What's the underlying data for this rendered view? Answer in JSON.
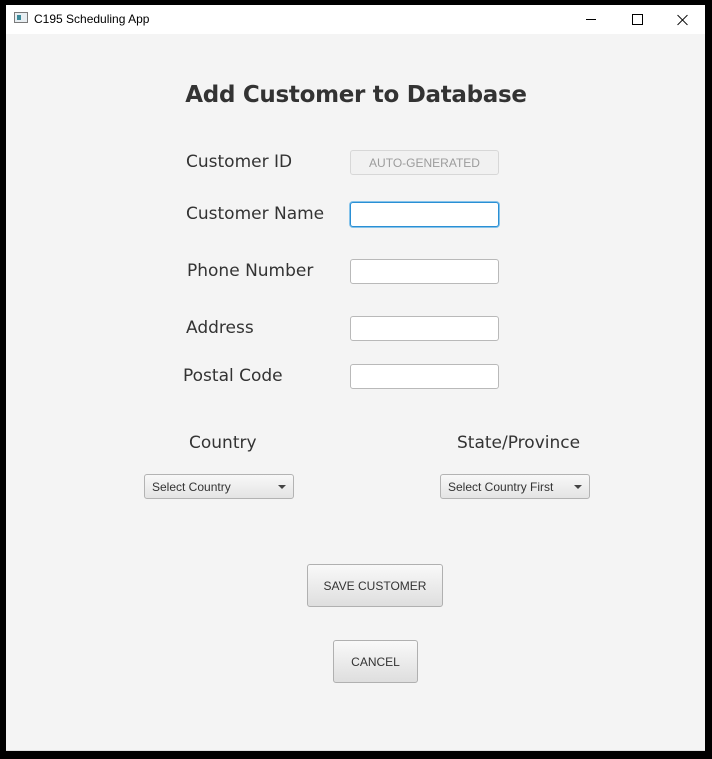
{
  "window": {
    "title": "C195 Scheduling App",
    "controls": {
      "minimize": "minimize",
      "maximize": "maximize",
      "close": "close"
    }
  },
  "form": {
    "heading": "Add Customer to Database",
    "fields": {
      "customer_id": {
        "label": "Customer ID",
        "value": "AUTO-GENERATED"
      },
      "customer_name": {
        "label": "Customer Name",
        "value": ""
      },
      "phone_number": {
        "label": "Phone Number",
        "value": ""
      },
      "address": {
        "label": "Address",
        "value": ""
      },
      "postal_code": {
        "label": "Postal Code",
        "value": ""
      }
    },
    "country": {
      "label": "Country",
      "selected": "Select Country"
    },
    "state": {
      "label": "State/Province",
      "selected": "Select Country First"
    },
    "buttons": {
      "save": "SAVE CUSTOMER",
      "cancel": "CANCEL"
    }
  },
  "colors": {
    "background": "#f4f4f4",
    "titlebar": "#ffffff",
    "focus": "#2a8fd4",
    "text": "#333333"
  }
}
